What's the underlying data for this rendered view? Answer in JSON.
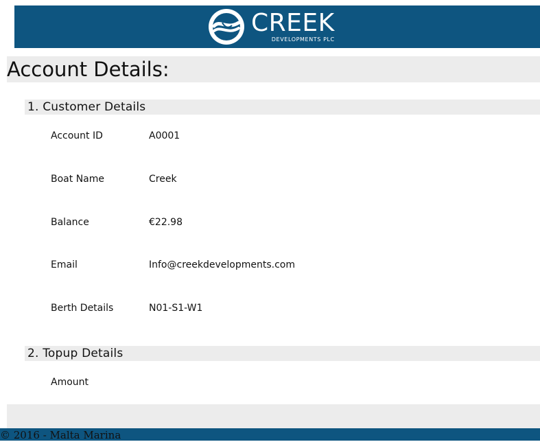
{
  "header": {
    "logo_word": "CREEK",
    "logo_sub": "DEVELOPMENTS PLC",
    "brand_color": "#0e5580"
  },
  "page": {
    "title": "Account Details:"
  },
  "sections": [
    {
      "title": "1.  Customer Details",
      "fields": [
        {
          "label": "Account ID",
          "value": "A0001"
        },
        {
          "label": "Boat Name",
          "value": "Creek"
        },
        {
          "label": "Balance",
          "value": "€22.98"
        },
        {
          "label": "Email",
          "value": "Info@creekdevelopments.com"
        },
        {
          "label": "Berth Details",
          "value": "N01-S1-W1"
        }
      ]
    },
    {
      "title": "2.  Topup Details",
      "fields": [
        {
          "label": "Amount",
          "value": ""
        }
      ]
    }
  ],
  "footer": {
    "text": "© 2016 - Malta Marina"
  }
}
